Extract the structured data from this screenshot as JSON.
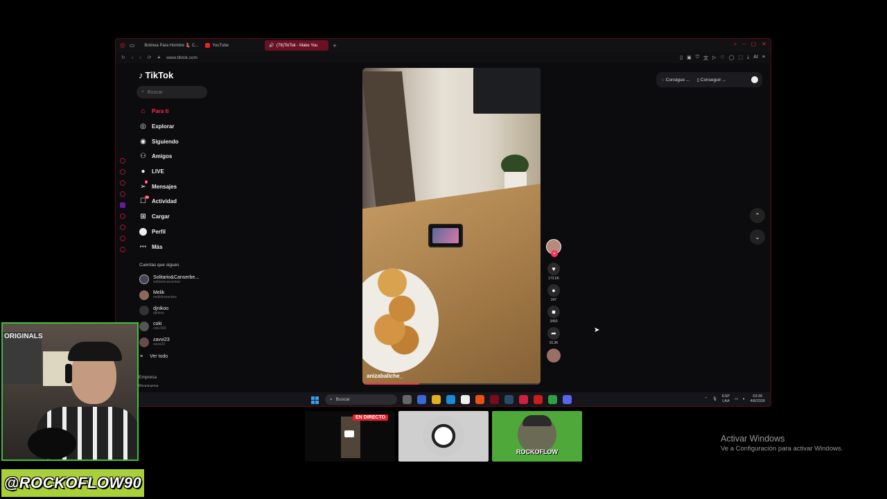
{
  "browser": {
    "tabs": [
      {
        "label": "Botinea Para Hombre 👢 C...",
        "active": false
      },
      {
        "label": "YouTube",
        "active": false
      },
      {
        "label": "(79)TikTok - Make You",
        "active": true
      }
    ],
    "url": "www.tiktok.com"
  },
  "tiktok": {
    "logo": "TikTok",
    "search_placeholder": "Buscar",
    "nav": [
      {
        "label": "Para ti",
        "icon": "home-icon",
        "active": true
      },
      {
        "label": "Explorar",
        "icon": "compass-icon"
      },
      {
        "label": "Siguiendo",
        "icon": "following-icon"
      },
      {
        "label": "Amigos",
        "icon": "friends-icon"
      },
      {
        "label": "LIVE",
        "icon": "live-icon"
      },
      {
        "label": "Mensajes",
        "icon": "messages-icon",
        "badge": "6"
      },
      {
        "label": "Actividad",
        "icon": "activity-icon",
        "badge": "79"
      },
      {
        "label": "Cargar",
        "icon": "upload-icon"
      },
      {
        "label": "Perfil",
        "icon": "profile-icon"
      },
      {
        "label": "Más",
        "icon": "more-icon"
      }
    ],
    "following_title": "Cuentas que sigues",
    "following": [
      {
        "name": "Solitario&Canserbe...",
        "handle": "solitariocanserber"
      },
      {
        "name": "Melik",
        "handle": "melikfernandez"
      },
      {
        "name": "djnikoo",
        "handle": "djnikoo"
      },
      {
        "name": "coki",
        "handle": "coki.999"
      },
      {
        "name": "zavvi23",
        "handle": "zavvi23"
      }
    ],
    "see_all": "Ver todo",
    "footer": [
      "Empresa",
      "Programa"
    ],
    "video": {
      "creator": "anizabaliche_",
      "progress": 0.32
    },
    "actions": [
      {
        "name": "like",
        "icon": "♥",
        "count": "173.5K"
      },
      {
        "name": "comment",
        "icon": "●",
        "count": "247"
      },
      {
        "name": "save",
        "icon": "■",
        "count": "3450"
      },
      {
        "name": "share",
        "icon": "➦",
        "count": "16.3K"
      }
    ],
    "promo": {
      "a": "Consigue ...",
      "b": "Conseguir ..."
    }
  },
  "taskbar": {
    "search": "Buscar",
    "lang1": "ESP",
    "lang2": "LAA",
    "time": "03:36",
    "date": "4/8/2026"
  },
  "overlay": {
    "handle": "@ROCKOFLOW90",
    "poster_text": "ORIGINALS",
    "live_badge": "EN DIRECTO",
    "thumb3_text": "ROCKOFLOW",
    "activate_title": "Activar Windows",
    "activate_sub": "Ve a Configuración para activar Windows."
  }
}
